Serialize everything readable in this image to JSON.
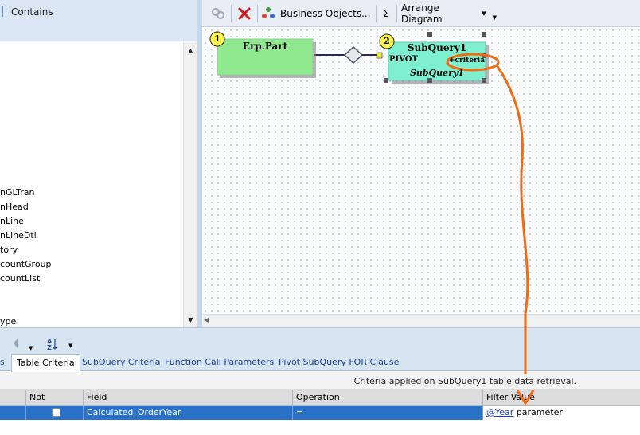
{
  "left_panel": {
    "header_label": "Contains",
    "items": [
      "nGLTran",
      "nHead",
      "nLine",
      "nLineDtl",
      "tory",
      "countGroup",
      "countList",
      "",
      "ype"
    ]
  },
  "toolbar": {
    "business_objects_label": "Business Objects...",
    "sum_label": "Σ",
    "arrange_label": "Arrange Diagram"
  },
  "diagram": {
    "node1": {
      "number": "1",
      "title": "Erp.Part"
    },
    "node2": {
      "number": "2",
      "title": "SubQuery1",
      "pivot_label": "PIVOT",
      "criteria_label": "+criteria",
      "subtitle": "SubQuery1"
    }
  },
  "bottom_tabs": [
    "s",
    "Table Criteria",
    "SubQuery Criteria",
    "Function Call Parameters",
    "Pivot SubQuery FOR Clause"
  ],
  "info_text": "Criteria applied on SubQuery1 table data retrieval.",
  "grid": {
    "columns": [
      "Not",
      "Field",
      "Operation",
      "Filter Value"
    ],
    "row": {
      "not": "",
      "field": "Calculated_OrderYear",
      "operation": "=",
      "filter_link": "@Year",
      "filter_rest": " parameter"
    }
  },
  "colors": {
    "node1_fill": "#8fe98f",
    "node2_fill": "#7ef0cf",
    "annotation": "#f26a12",
    "selection": "#2a72c8"
  }
}
